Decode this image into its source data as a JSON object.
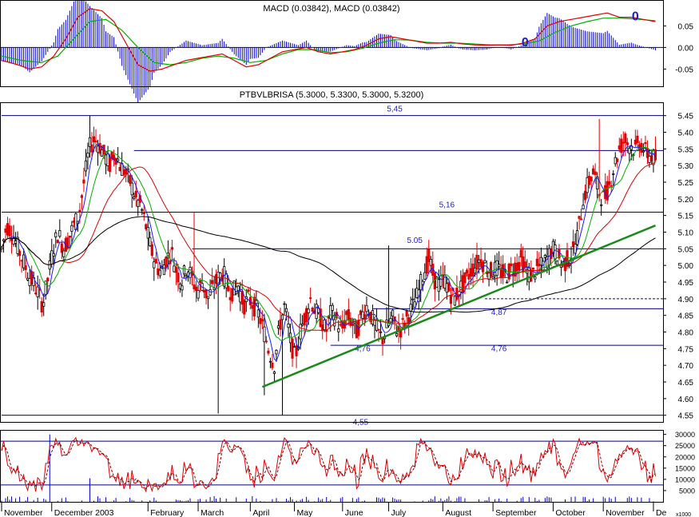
{
  "colors": {
    "background": "#ffffff",
    "grid": "#000080",
    "label_blue": "#1c1ccc",
    "up_candle": "#000000",
    "down_candle": "#e00000",
    "ma_short": "#1a1aff",
    "ma_mid": "#00b000",
    "ma_long": "#e00000",
    "ma_200": "#000000",
    "trendline": "#1a8a1a",
    "stoch_k": "#e00000",
    "stoch_d": "#800000",
    "volume": "#0000cc",
    "macd_hist": "#0000cc"
  },
  "chart_data": [
    {
      "type": "line",
      "panel": "macd",
      "title": "MACD (0.03842), MACD (0.03842)",
      "ylim": [
        -0.09,
        0.11
      ],
      "yticks": [
        0.05,
        0.0,
        -0.05
      ],
      "ytick_labels": [
        "0.05",
        "0.00",
        "-0.05"
      ],
      "markers": [
        {
          "label": "0",
          "x": 261,
          "y": 0.012
        },
        {
          "label": "0",
          "x": 316,
          "y": 0.072
        }
      ],
      "series": [
        {
          "role": "macd",
          "points": [
            [
              0,
              -0.03
            ],
            [
              8,
              -0.04
            ],
            [
              14,
              -0.05
            ],
            [
              20,
              -0.045
            ],
            [
              26,
              -0.02
            ],
            [
              32,
              0.02
            ],
            [
              38,
              0.07
            ],
            [
              44,
              0.09
            ],
            [
              50,
              0.085
            ],
            [
              56,
              0.06
            ],
            [
              62,
              0.01
            ],
            [
              68,
              -0.04
            ],
            [
              74,
              -0.055
            ],
            [
              80,
              -0.05
            ],
            [
              86,
              -0.04
            ],
            [
              92,
              -0.03
            ],
            [
              98,
              -0.025
            ],
            [
              104,
              -0.02
            ],
            [
              110,
              -0.015
            ],
            [
              116,
              -0.03
            ],
            [
              122,
              -0.045
            ],
            [
              128,
              -0.04
            ],
            [
              134,
              -0.025
            ],
            [
              140,
              -0.01
            ],
            [
              146,
              -0.005
            ],
            [
              152,
              0.0
            ],
            [
              158,
              -0.01
            ],
            [
              164,
              -0.015
            ],
            [
              170,
              -0.01
            ],
            [
              176,
              -0.005
            ],
            [
              182,
              0.005
            ],
            [
              188,
              0.02
            ],
            [
              194,
              0.025
            ],
            [
              200,
              0.02
            ],
            [
              206,
              0.015
            ],
            [
              212,
              0.01
            ],
            [
              218,
              0.01
            ],
            [
              224,
              0.012
            ],
            [
              230,
              0.008
            ],
            [
              236,
              0.006
            ],
            [
              242,
              0.005
            ],
            [
              248,
              0.006
            ],
            [
              254,
              0.005
            ],
            [
              260,
              0.01
            ],
            [
              266,
              0.02
            ],
            [
              272,
              0.05
            ],
            [
              278,
              0.06
            ],
            [
              284,
              0.065
            ],
            [
              290,
              0.07
            ],
            [
              296,
              0.075
            ],
            [
              302,
              0.08
            ],
            [
              308,
              0.07
            ],
            [
              314,
              0.07
            ],
            [
              320,
              0.065
            ],
            [
              326,
              0.06
            ]
          ]
        },
        {
          "role": "signal",
          "points": [
            [
              0,
              -0.02
            ],
            [
              10,
              -0.03
            ],
            [
              20,
              -0.035
            ],
            [
              28,
              -0.02
            ],
            [
              36,
              0.02
            ],
            [
              44,
              0.06
            ],
            [
              52,
              0.065
            ],
            [
              60,
              0.04
            ],
            [
              68,
              0.0
            ],
            [
              76,
              -0.035
            ],
            [
              84,
              -0.04
            ],
            [
              92,
              -0.035
            ],
            [
              100,
              -0.025
            ],
            [
              108,
              -0.02
            ],
            [
              116,
              -0.025
            ],
            [
              124,
              -0.035
            ],
            [
              132,
              -0.03
            ],
            [
              140,
              -0.015
            ],
            [
              148,
              -0.005
            ],
            [
              156,
              -0.005
            ],
            [
              164,
              -0.012
            ],
            [
              172,
              -0.01
            ],
            [
              180,
              -0.002
            ],
            [
              188,
              0.01
            ],
            [
              196,
              0.018
            ],
            [
              204,
              0.017
            ],
            [
              212,
              0.012
            ],
            [
              220,
              0.01
            ],
            [
              228,
              0.01
            ],
            [
              236,
              0.008
            ],
            [
              244,
              0.006
            ],
            [
              252,
              0.006
            ],
            [
              260,
              0.008
            ],
            [
              268,
              0.015
            ],
            [
              276,
              0.035
            ],
            [
              284,
              0.05
            ],
            [
              292,
              0.06
            ],
            [
              300,
              0.068
            ],
            [
              308,
              0.068
            ],
            [
              316,
              0.066
            ],
            [
              326,
              0.062
            ]
          ]
        }
      ]
    },
    {
      "type": "candlestick",
      "panel": "price",
      "title": "PTBVLBRISA (5.3000, 5.3300, 5.3000, 5.3200)",
      "ylim": [
        4.53,
        5.49
      ],
      "yticks": [
        5.45,
        5.4,
        5.35,
        5.3,
        5.25,
        5.2,
        5.15,
        5.1,
        5.05,
        5.0,
        4.95,
        4.9,
        4.85,
        4.8,
        4.75,
        4.7,
        4.65,
        4.6,
        4.55
      ],
      "ytick_labels": [
        "5.45",
        "5.40",
        "5.35",
        "5.30",
        "5.25",
        "5.20",
        "5.15",
        "5.10",
        "5.05",
        "5.00",
        "4.95",
        "4.90",
        "4.85",
        "4.80",
        "4.75",
        "4.70",
        "4.65",
        "4.60",
        "4.55"
      ],
      "level_lines": [
        {
          "value": 5.45,
          "label": "5,45",
          "x_start": 0
        },
        {
          "value": 5.345,
          "label": "",
          "x_start": 66
        },
        {
          "value": 5.16,
          "label": "5,16",
          "x_start": 0
        },
        {
          "value": 5.05,
          "label": "5.05",
          "x_start": 95
        },
        {
          "value": 4.87,
          "label": "4,87",
          "x_start": 185
        },
        {
          "value": 4.76,
          "label": "4,76",
          "x_start": 164
        },
        {
          "value": 4.55,
          "label": "4,55",
          "x_start": 0
        }
      ],
      "dashed_level": {
        "value": 4.9,
        "x_start": 241
      },
      "trendline": {
        "from": [
          130,
          4.635
        ],
        "to": [
          326,
          5.12
        ]
      },
      "closes": [
        5.05,
        5.12,
        5.1,
        5.06,
        5.02,
        4.98,
        4.95,
        4.92,
        4.88,
        4.96,
        5.05,
        5.1,
        5.05,
        5.08,
        5.12,
        5.15,
        5.25,
        5.35,
        5.38,
        5.36,
        5.33,
        5.3,
        5.34,
        5.3,
        5.28,
        5.25,
        5.2,
        5.18,
        5.12,
        5.05,
        5.0,
        4.98,
        5.02,
        5.04,
        4.98,
        4.95,
        5.0,
        4.96,
        4.92,
        4.95,
        4.9,
        4.93,
        4.96,
        4.98,
        4.93,
        4.92,
        4.94,
        4.88,
        4.9,
        4.88,
        4.85,
        4.8,
        4.74,
        4.7,
        4.82,
        4.88,
        4.78,
        4.72,
        4.8,
        4.85,
        4.9,
        4.86,
        4.84,
        4.8,
        4.86,
        4.84,
        4.8,
        4.85,
        4.83,
        4.8,
        4.85,
        4.88,
        4.84,
        4.8,
        4.78,
        4.82,
        4.84,
        4.8,
        4.82,
        4.85,
        4.88,
        4.92,
        4.98,
        5.02,
        4.96,
        4.94,
        4.96,
        4.92,
        4.9,
        4.93,
        4.95,
        4.98,
        5.0,
        5.02,
        5.0,
        4.98,
        4.99,
        4.98,
        4.97,
        4.99,
        5.0,
        5.02,
        4.98,
        4.97,
        4.99,
        5.0,
        5.02,
        5.05,
        5.03,
        5.0,
        5.02,
        5.04,
        5.1,
        5.2,
        5.25,
        5.28,
        5.22,
        5.2,
        5.24,
        5.3,
        5.35,
        5.38,
        5.36,
        5.35,
        5.37,
        5.34,
        5.33,
        5.32
      ],
      "x_labels": [
        "November",
        "December 2003",
        "February",
        "March",
        "April",
        "May",
        "June",
        "July",
        "August",
        "September",
        "October",
        "November",
        "De"
      ],
      "x_label_pos": [
        0,
        25,
        73,
        98,
        124,
        146,
        170,
        193,
        220,
        245,
        275,
        300,
        325
      ],
      "ma_names": [
        "short",
        "mid",
        "long",
        "200"
      ],
      "ma_lengths": [
        5,
        12,
        30,
        120
      ]
    },
    {
      "type": "line",
      "panel": "stochastic_volume",
      "ylim": [
        0,
        32000
      ],
      "yticks": [
        30000,
        25000,
        20000,
        15000,
        10000,
        5000
      ],
      "ytick_labels": [
        "30000",
        "25000",
        "20000",
        "15000",
        "10000",
        "5000"
      ],
      "unit_label": "x1000",
      "ref_lines": [
        27000,
        7500
      ],
      "volume_peaks": [
        [
          24,
          30000
        ],
        [
          44,
          10500
        ]
      ],
      "k_period": 14
    }
  ]
}
